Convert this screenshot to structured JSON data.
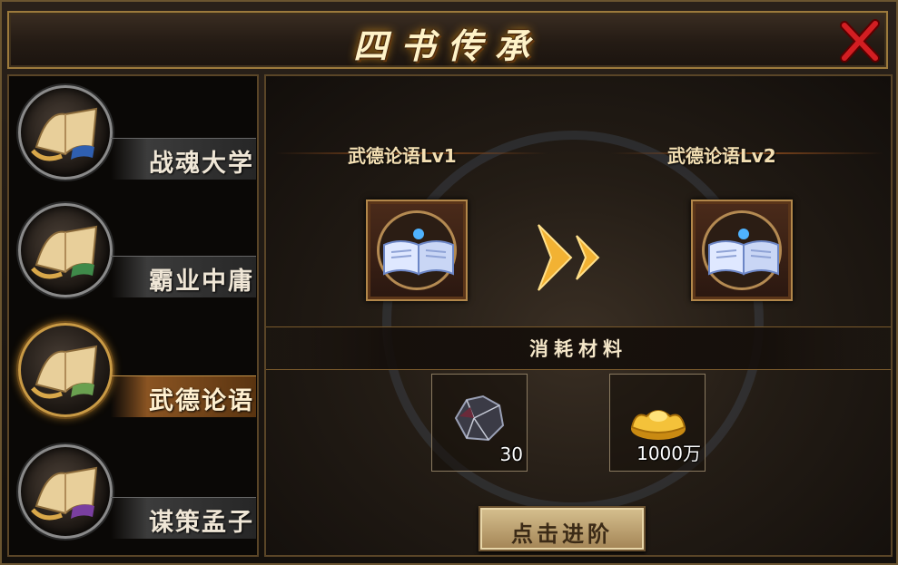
{
  "window": {
    "title": "四书传承"
  },
  "sidebar": {
    "items": [
      {
        "label": "战魂大学",
        "active": false,
        "accent": "#2f5fb0"
      },
      {
        "label": "霸业中庸",
        "active": false,
        "accent": "#3f8a4a"
      },
      {
        "label": "武德论语",
        "active": true,
        "accent": "#6aa050"
      },
      {
        "label": "谋策孟子",
        "active": false,
        "accent": "#7a3fa0"
      }
    ]
  },
  "upgrade": {
    "from_label": "武德论语Lv1",
    "to_label": "武德论语Lv2",
    "consume_label": "消耗材料",
    "materials": [
      {
        "icon": "ore-icon",
        "count": "30"
      },
      {
        "icon": "gold-ingot-icon",
        "count": "1000万"
      }
    ],
    "button_label": "点击进阶"
  },
  "colors": {
    "accent_gold": "#c99a45",
    "close_red": "#c0151b"
  }
}
